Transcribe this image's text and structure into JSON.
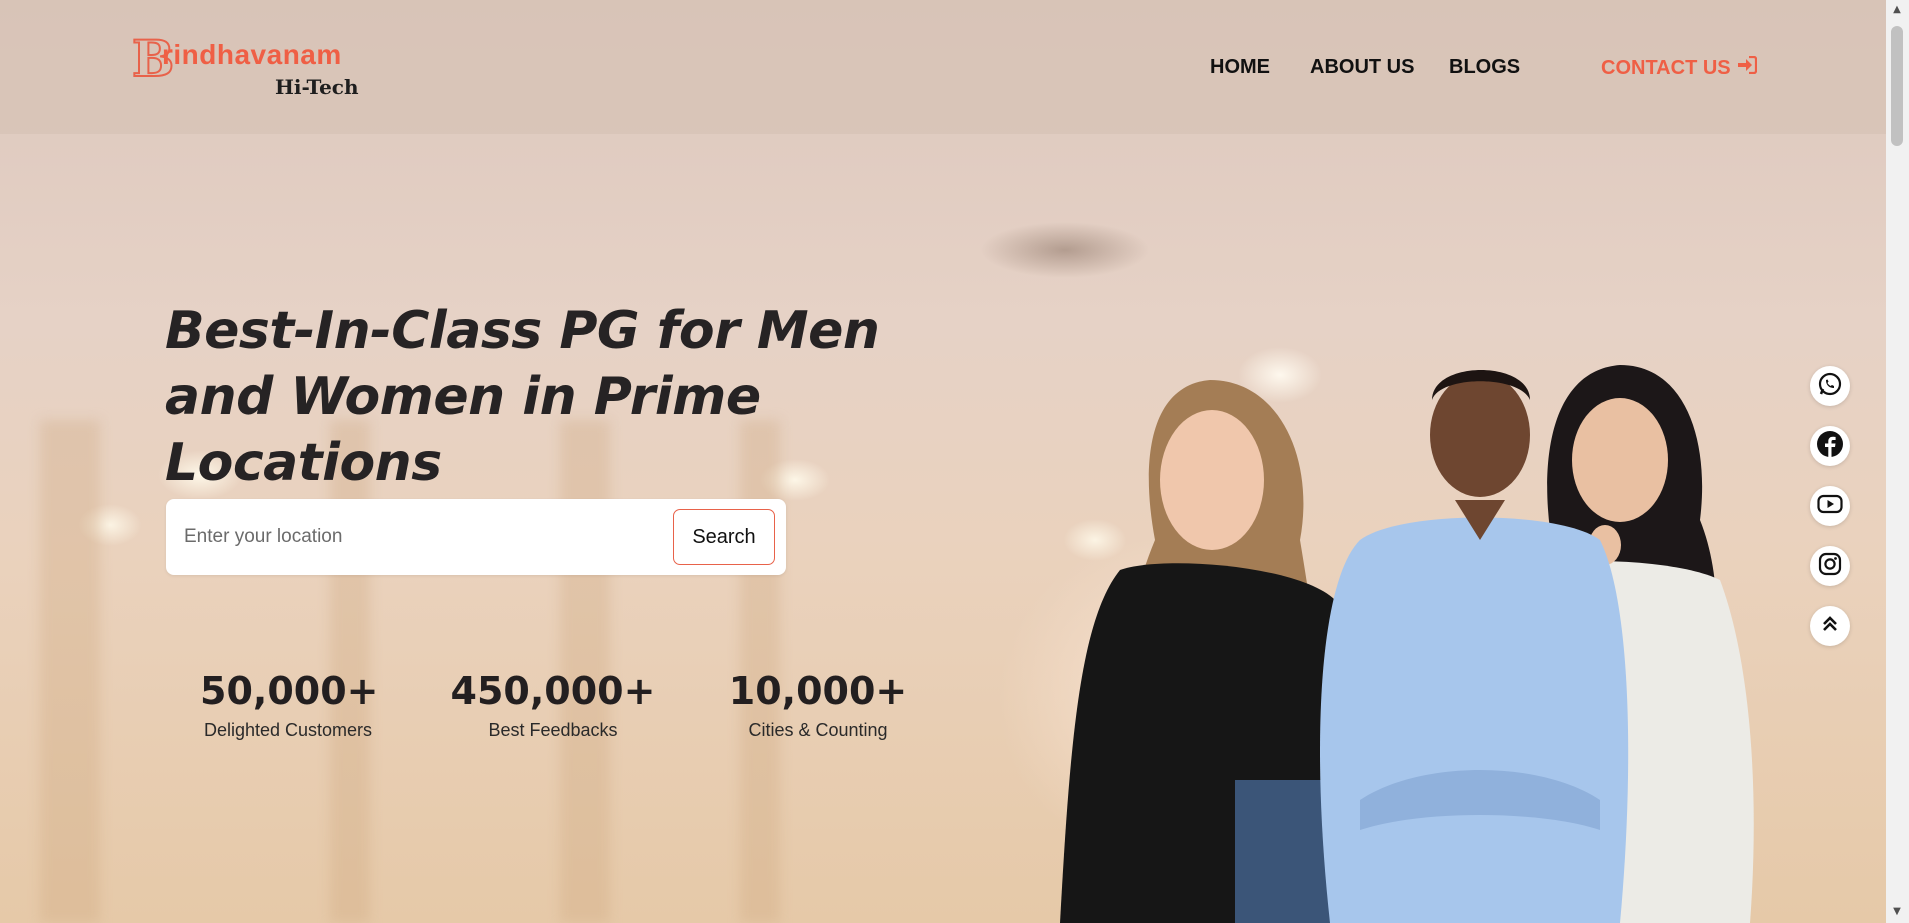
{
  "brand": {
    "initial": "B",
    "name": "rindhavanam",
    "sub": "Hi-Tech"
  },
  "nav": {
    "home": "HOME",
    "about": "ABOUT US",
    "blogs": "BLOGS",
    "contact": "CONTACT US"
  },
  "hero": {
    "headline": "Best-In-Class PG for Men and Women in Prime Locations",
    "search_placeholder": "Enter your location",
    "search_button": "Search"
  },
  "stats": [
    {
      "value": "50,000+",
      "label": "Delighted Customers"
    },
    {
      "value": "450,000+",
      "label": "Best Feedbacks"
    },
    {
      "value": "10,000+",
      "label": "Cities & Counting"
    }
  ],
  "social": [
    "whatsapp-icon",
    "facebook-icon",
    "youtube-icon",
    "instagram-icon",
    "scroll-top-icon"
  ],
  "colors": {
    "accent": "#ef5f45",
    "text_dark": "#262324"
  }
}
